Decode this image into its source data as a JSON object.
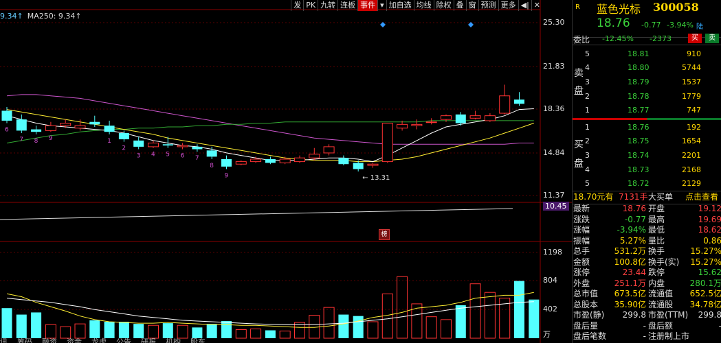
{
  "toolbar": {
    "items": [
      "发",
      "PK",
      "九转",
      "连板",
      "事件",
      "▾",
      "加自选",
      "均线",
      "除权",
      "叠",
      "窗",
      "预测",
      "更多",
      "◀|",
      "✕"
    ],
    "active": "事件"
  },
  "ma_legend": [
    {
      "text": "9.34↑",
      "color": "#66ccff"
    },
    {
      "text": "MA250: 9.34↑",
      "color": "#dddddd"
    }
  ],
  "price_axis": [
    "25.30",
    "21.83",
    "18.36",
    "14.84",
    "11.37",
    "10.45"
  ],
  "volume_axis": [
    "1198",
    "804",
    "402",
    "万"
  ],
  "low_marker": "13.31",
  "event_badge": "榜",
  "count_labels": [
    "6",
    "7",
    "8",
    "9",
    "1",
    "2",
    "3",
    "4",
    "5",
    "6",
    "7",
    "8",
    "9"
  ],
  "bottom_tabs": [
    "讯",
    "筹码",
    "融资",
    "资金",
    "龙虎",
    "公告",
    "研报",
    "机构",
    "股东"
  ],
  "candles": [
    {
      "o": 18.2,
      "c": 17.4,
      "h": 18.5,
      "l": 17.2,
      "up": false
    },
    {
      "o": 17.5,
      "c": 16.6,
      "h": 17.9,
      "l": 16.4,
      "up": false
    },
    {
      "o": 16.7,
      "c": 16.5,
      "h": 17.0,
      "l": 16.3,
      "up": false
    },
    {
      "o": 16.6,
      "c": 17.0,
      "h": 17.3,
      "l": 16.5,
      "up": true
    },
    {
      "o": 17.0,
      "c": 17.2,
      "h": 17.5,
      "l": 16.8,
      "up": true
    },
    {
      "o": 16.8,
      "c": 17.0,
      "h": 17.5,
      "l": 16.6,
      "up": true
    },
    {
      "o": 17.3,
      "c": 17.1,
      "h": 17.8,
      "l": 16.9,
      "up": false
    },
    {
      "o": 17.0,
      "c": 16.5,
      "h": 17.4,
      "l": 16.3,
      "up": false
    },
    {
      "o": 16.4,
      "c": 15.9,
      "h": 16.6,
      "l": 15.7,
      "up": false
    },
    {
      "o": 15.8,
      "c": 15.3,
      "h": 16.1,
      "l": 15.1,
      "up": false
    },
    {
      "o": 15.3,
      "c": 15.6,
      "h": 15.8,
      "l": 15.2,
      "up": true
    },
    {
      "o": 15.5,
      "c": 15.4,
      "h": 16.1,
      "l": 15.2,
      "up": false
    },
    {
      "o": 15.3,
      "c": 15.4,
      "h": 15.6,
      "l": 15.1,
      "up": false
    },
    {
      "o": 15.3,
      "c": 15.1,
      "h": 15.5,
      "l": 14.9,
      "up": false
    },
    {
      "o": 15.0,
      "c": 14.5,
      "h": 15.3,
      "l": 14.3,
      "up": false
    },
    {
      "o": 14.3,
      "c": 13.7,
      "h": 14.6,
      "l": 13.5,
      "up": false
    },
    {
      "o": 13.9,
      "c": 14.1,
      "h": 14.2,
      "l": 13.8,
      "up": true
    },
    {
      "o": 14.1,
      "c": 14.3,
      "h": 14.5,
      "l": 14.0,
      "up": true
    },
    {
      "o": 14.3,
      "c": 14.0,
      "h": 14.5,
      "l": 13.9,
      "up": true
    },
    {
      "o": 14.0,
      "c": 14.3,
      "h": 14.5,
      "l": 13.9,
      "up": true
    },
    {
      "o": 14.1,
      "c": 14.4,
      "h": 14.6,
      "l": 14.0,
      "up": true
    },
    {
      "o": 14.4,
      "c": 14.7,
      "h": 15.2,
      "l": 14.2,
      "up": true
    },
    {
      "o": 14.8,
      "c": 15.3,
      "h": 15.5,
      "l": 14.6,
      "up": false
    },
    {
      "o": 14.4,
      "c": 13.9,
      "h": 14.6,
      "l": 13.8,
      "up": false
    },
    {
      "o": 14.0,
      "c": 13.5,
      "h": 14.2,
      "l": 13.31,
      "up": false
    },
    {
      "o": 13.8,
      "c": 13.9,
      "h": 14.0,
      "l": 13.6,
      "up": true
    },
    {
      "o": 14.1,
      "c": 17.2,
      "h": 17.2,
      "l": 14.0,
      "up": true
    },
    {
      "o": 16.8,
      "c": 17.1,
      "h": 17.4,
      "l": 16.6,
      "up": true
    },
    {
      "o": 17.0,
      "c": 17.1,
      "h": 17.5,
      "l": 16.7,
      "up": true
    },
    {
      "o": 17.3,
      "c": 17.3,
      "h": 17.6,
      "l": 17.1,
      "up": true
    },
    {
      "o": 17.5,
      "c": 17.8,
      "h": 17.9,
      "l": 17.3,
      "up": true
    },
    {
      "o": 17.9,
      "c": 17.2,
      "h": 18.1,
      "l": 17.0,
      "up": false
    },
    {
      "o": 17.6,
      "c": 17.8,
      "h": 18.2,
      "l": 17.5,
      "up": true
    },
    {
      "o": 17.4,
      "c": 17.8,
      "h": 18.0,
      "l": 17.3,
      "up": true
    },
    {
      "o": 18.0,
      "c": 19.4,
      "h": 20.3,
      "l": 17.9,
      "up": true
    },
    {
      "o": 19.1,
      "c": 18.76,
      "h": 19.7,
      "l": 18.6,
      "up": false
    }
  ],
  "volumes": [
    420,
    330,
    360,
    190,
    160,
    200,
    250,
    230,
    230,
    200,
    180,
    210,
    180,
    150,
    200,
    240,
    120,
    130,
    110,
    100,
    220,
    320,
    430,
    330,
    310,
    230,
    620,
    860,
    480,
    300,
    260,
    460,
    760,
    640,
    560,
    800,
    540
  ],
  "ma5": [
    17.8,
    17.5,
    17.2,
    17.0,
    16.9,
    16.8,
    16.7,
    16.6,
    16.4,
    16.1,
    15.8,
    15.6,
    15.4,
    15.3,
    15.1,
    14.8,
    14.6,
    14.4,
    14.2,
    14.2,
    14.2,
    14.3,
    14.4,
    14.4,
    14.3,
    14.1,
    14.6,
    15.2,
    15.8,
    16.4,
    16.9,
    17.1,
    17.3,
    17.5,
    17.8,
    18.3,
    18.36
  ],
  "ma10": [
    18.3,
    18.1,
    17.9,
    17.7,
    17.5,
    17.3,
    17.1,
    16.9,
    16.7,
    16.5,
    16.3,
    16.0,
    15.8,
    15.6,
    15.4,
    15.2,
    15.0,
    14.8,
    14.6,
    14.4,
    14.3,
    14.2,
    14.2,
    14.2,
    14.1,
    14.1,
    14.2,
    14.3,
    14.5,
    14.8,
    15.1,
    15.4,
    15.7,
    16.0,
    16.4,
    16.8,
    17.2
  ],
  "ma30": [
    19.4,
    19.5,
    19.5,
    19.4,
    19.3,
    19.2,
    19.0,
    18.8,
    18.6,
    18.4,
    18.2,
    18.0,
    17.8,
    17.6,
    17.4,
    17.2,
    17.0,
    16.8,
    16.6,
    16.4,
    16.2,
    16.0,
    15.9,
    15.8,
    15.7,
    15.6,
    15.5,
    15.5,
    15.5,
    15.5,
    15.5,
    15.5,
    15.5,
    15.5,
    15.5,
    15.6,
    15.6
  ],
  "ma60": [
    15.6,
    15.8,
    16.0,
    16.2,
    16.3,
    16.5,
    16.6,
    16.7,
    16.7,
    16.8,
    16.8,
    16.9,
    16.9,
    17.0,
    17.0,
    17.1,
    17.1,
    17.2,
    17.2,
    17.3,
    17.3,
    17.3,
    17.3,
    17.3,
    17.3,
    17.3,
    17.3,
    17.3,
    17.3,
    17.4,
    17.4,
    17.4,
    17.4,
    17.4,
    17.4,
    17.4,
    17.4
  ],
  "vol_ma5": [
    620,
    580,
    500,
    440,
    380,
    310,
    260,
    230,
    220,
    210,
    210,
    220,
    210,
    200,
    190,
    190,
    180,
    180,
    170,
    160,
    150,
    150,
    170,
    200,
    240,
    290,
    320,
    360,
    420,
    440,
    460,
    500,
    560,
    580,
    600,
    600,
    640
  ],
  "vol_ma10": [
    560,
    540,
    520,
    500,
    470,
    440,
    400,
    370,
    340,
    310,
    290,
    270,
    250,
    240,
    230,
    220,
    210,
    200,
    195,
    190,
    190,
    190,
    200,
    210,
    230,
    250,
    270,
    300,
    330,
    360,
    390,
    420,
    440,
    460,
    480,
    500,
    510
  ],
  "panel": {
    "r_label": "R",
    "stock_name": "蓝色光标",
    "stock_code": "300058",
    "price": "18.76",
    "change": "-0.77",
    "change_pct": "-3.94%",
    "exchange": "陆",
    "weibi_label": "委比",
    "weibi_pct": "-12.45%",
    "weibi_diff": "-2373",
    "buy_btn": "买",
    "sell_btn": "卖",
    "sell_side_label": [
      "卖",
      "盘"
    ],
    "buy_side_label": [
      "买",
      "盘"
    ],
    "asks": [
      {
        "level": "5",
        "price": "18.81",
        "vol": "910"
      },
      {
        "level": "4",
        "price": "18.80",
        "vol": "5744"
      },
      {
        "level": "3",
        "price": "18.79",
        "vol": "1537"
      },
      {
        "level": "2",
        "price": "18.78",
        "vol": "1779"
      },
      {
        "level": "1",
        "price": "18.77",
        "vol": "747"
      }
    ],
    "bids": [
      {
        "level": "1",
        "price": "18.76",
        "vol": "192"
      },
      {
        "level": "2",
        "price": "18.75",
        "vol": "1654"
      },
      {
        "level": "3",
        "price": "18.74",
        "vol": "2201"
      },
      {
        "level": "4",
        "price": "18.73",
        "vol": "2168"
      },
      {
        "level": "5",
        "price": "18.72",
        "vol": "2129"
      }
    ],
    "bigorder": {
      "price": "18.70元有",
      "vol": "7131手",
      "label": "大买单",
      "action": "点击查看"
    },
    "stats": [
      {
        "l1": "最新",
        "v1": "18.76",
        "c1": "#ff4040",
        "l2": "开盘",
        "v2": "19.12",
        "c2": "#ff4040"
      },
      {
        "l1": "涨跌",
        "v1": "-0.77",
        "c1": "#3ad13a",
        "l2": "最高",
        "v2": "19.69",
        "c2": "#ff4040"
      },
      {
        "l1": "涨幅",
        "v1": "-3.94%",
        "c1": "#3ad13a",
        "l2": "最低",
        "v2": "18.62",
        "c2": "#ff4040"
      },
      {
        "l1": "振幅",
        "v1": "5.27%",
        "c1": "#ffd700",
        "l2": "量比",
        "v2": "0.86",
        "c2": "#ffd700"
      },
      {
        "l1": "总手",
        "v1": "531.2万",
        "c1": "#ffd700",
        "l2": "换手",
        "v2": "15.27%",
        "c2": "#ffd700"
      },
      {
        "l1": "金额",
        "v1": "100.8亿",
        "c1": "#ffd700",
        "l2": "换手(实)",
        "v2": "15.27%",
        "c2": "#ffd700"
      },
      {
        "l1": "涨停",
        "v1": "23.44",
        "c1": "#ff4040",
        "l2": "跌停",
        "v2": "15.62",
        "c2": "#3ad13a"
      },
      {
        "l1": "外盘",
        "v1": "251.1万",
        "c1": "#ff4040",
        "l2": "内盘",
        "v2": "280.1万",
        "c2": "#3ad13a"
      },
      {
        "l1": "总市值",
        "v1": "673.5亿",
        "c1": "#ffd700",
        "l2": "流通值",
        "v2": "652.5亿",
        "c2": "#ffd700"
      },
      {
        "l1": "总股本",
        "v1": "35.90亿",
        "c1": "#ffd700",
        "l2": "流通股",
        "v2": "34.78亿",
        "c2": "#ffd700"
      },
      {
        "l1": "市盈(静)",
        "v1": "299.8",
        "c1": "#dddddd",
        "l2": "市盈(TTM)",
        "v2": "299.8",
        "c2": "#dddddd"
      },
      {
        "l1": "盘后量",
        "v1": "-",
        "c1": "#dddddd",
        "l2": "盘后额",
        "v2": "-",
        "c2": "#dddddd"
      },
      {
        "l1": "盘后笔数",
        "v1": "-",
        "c1": "#dddddd",
        "l2": "注册制上市",
        "v2": "",
        "c2": "#dddddd"
      }
    ]
  }
}
